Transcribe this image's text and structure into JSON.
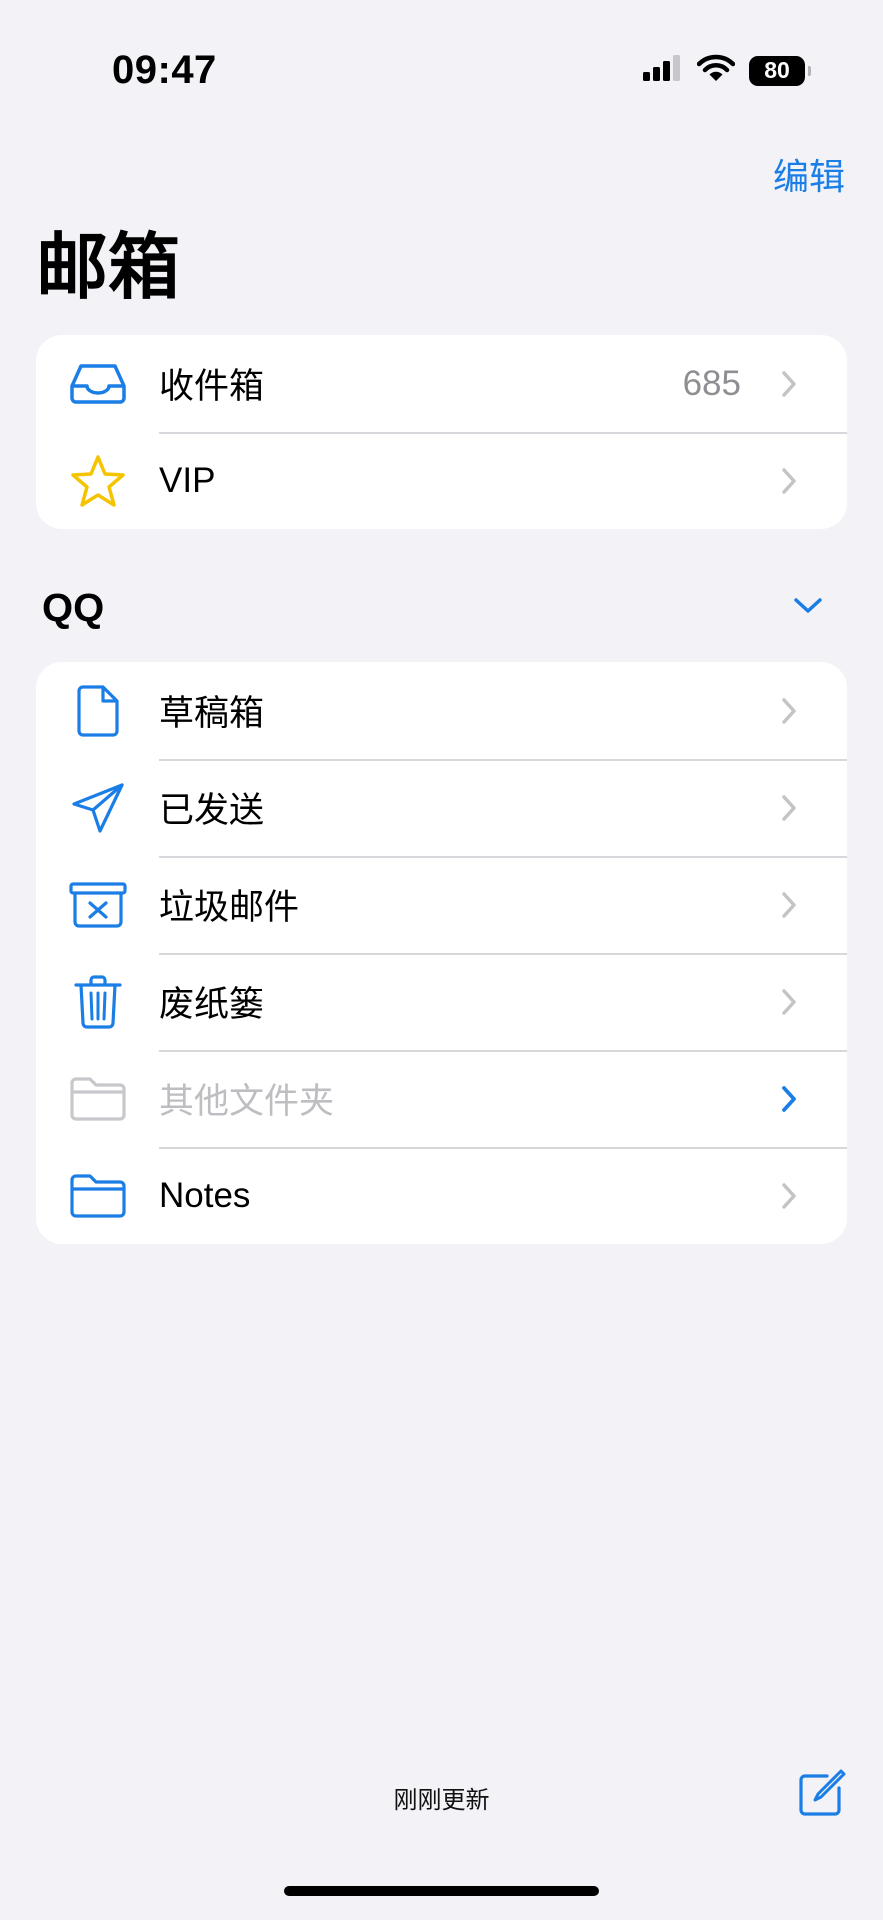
{
  "status_bar": {
    "time": "09:47",
    "battery": "80",
    "icons": [
      "cellular-signal-icon",
      "wifi-icon",
      "battery-icon"
    ]
  },
  "nav": {
    "edit_label": "编辑"
  },
  "title": "邮箱",
  "mailboxes": [
    {
      "icon": "inbox-icon",
      "label": "收件箱",
      "count": "685"
    },
    {
      "icon": "star-icon",
      "label": "VIP"
    }
  ],
  "account": {
    "name": "QQ",
    "toggle_icon": "chevron-down-icon",
    "folders": [
      {
        "icon": "draft-document-icon",
        "label": "草稿箱"
      },
      {
        "icon": "paper-plane-icon",
        "label": "已发送"
      },
      {
        "icon": "junk-box-icon",
        "label": "垃圾邮件"
      },
      {
        "icon": "trash-icon",
        "label": "废纸篓"
      },
      {
        "icon": "folder-icon",
        "label": "其他文件夹",
        "disabled": true
      },
      {
        "icon": "folder-icon",
        "label": "Notes"
      }
    ]
  },
  "footer": {
    "status": "刚刚更新",
    "compose_icon": "compose-icon"
  },
  "colors": {
    "accent": "#1a7ee6",
    "background": "#f2f2f7",
    "star": "#f5c400",
    "chevron": "#c4c4c7",
    "disabled": "#bdbdc2"
  }
}
